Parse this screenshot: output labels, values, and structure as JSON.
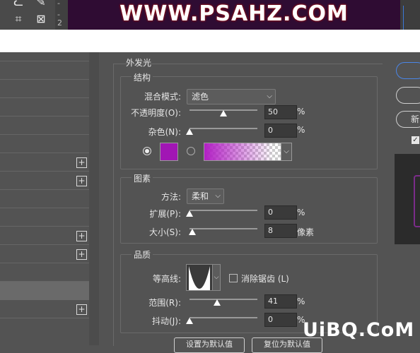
{
  "watermark_top": "WWW.PSAHZ.COM",
  "watermark_bottom": "UiBQ.CoM",
  "ruler_marks": [
    "-",
    "-",
    "2"
  ],
  "panel_title": "外发光",
  "structure": {
    "title": "结构",
    "blend_mode_label": "混合模式:",
    "blend_mode_value": "滤色",
    "opacity_label": "不透明度(O):",
    "opacity_value": "50",
    "opacity_unit": "%",
    "opacity_level": 0.5,
    "noise_label": "杂色(N):",
    "noise_value": "0",
    "noise_unit": "%",
    "noise_level": 0,
    "color_swatch": "#a116b4",
    "gradient_from": "#b21fc4"
  },
  "elements": {
    "title": "图素",
    "technique_label": "方法:",
    "technique_value": "柔和",
    "spread_label": "扩展(P):",
    "spread_value": "0",
    "spread_unit": "%",
    "spread_level": 0,
    "size_label": "大小(S):",
    "size_value": "8",
    "size_unit": "像素",
    "size_level": 0.04
  },
  "quality": {
    "title": "品质",
    "contour_label": "等高线:",
    "antialias_label": "消除锯齿 (L)",
    "antialias_checked": false,
    "range_label": "范围(R):",
    "range_value": "41",
    "range_unit": "%",
    "range_level": 0.41,
    "jitter_label": "抖动(J):",
    "jitter_value": "0",
    "jitter_unit": "%",
    "jitter_level": 0
  },
  "bottom_buttons": [
    "设置为默认值",
    "复位为默认值"
  ],
  "right_panel": {
    "new_button_partial": "新",
    "preview_checked": true
  }
}
